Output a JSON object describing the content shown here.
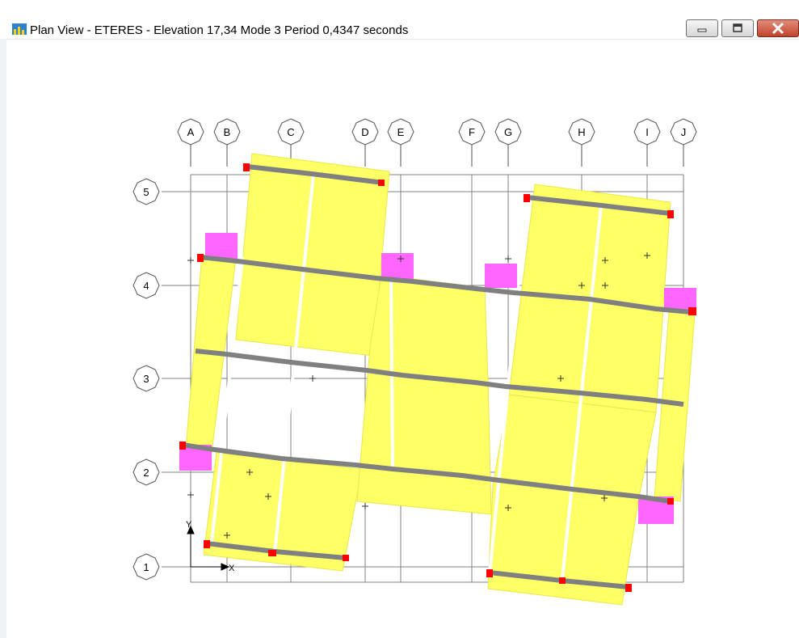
{
  "window": {
    "title": "Plan View - ETERES - Elevation 17,34  Mode 3  Period 0,4347 seconds",
    "minimize_label": "minimize",
    "maximize_label": "maximize",
    "close_label": "close"
  },
  "grid": {
    "columns": [
      "A",
      "B",
      "C",
      "D",
      "E",
      "F",
      "G",
      "H",
      "I",
      "J"
    ],
    "rows": [
      "5",
      "4",
      "3",
      "2",
      "1"
    ]
  },
  "axes": {
    "x_label": "X",
    "y_label": "Y"
  },
  "colors": {
    "slab": "#ffff66",
    "beam": "#808080",
    "wall": "#ff66ff",
    "support": "#ff0000",
    "grid_line": "#808080",
    "titlebar": "#ffffff"
  },
  "icons": [
    "app-icon",
    "minimize-icon",
    "maximize-icon",
    "close-icon"
  ]
}
